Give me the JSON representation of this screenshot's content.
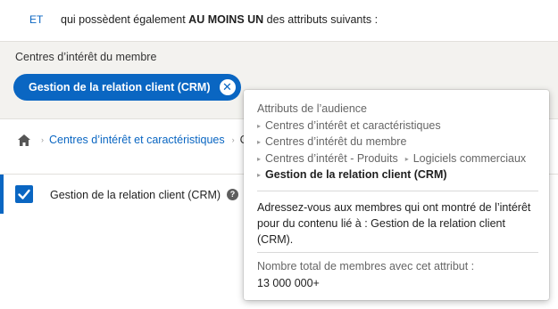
{
  "condition": {
    "operator": "ET",
    "text_before": "qui possèdent également ",
    "emphasis": "AU MOINS UN",
    "text_after": " des attributs suivants :"
  },
  "interests": {
    "label": "Centres d’intérêt du membre",
    "selected_pill": "Gestion de la relation client (CRM)",
    "remove_icon": "close-circle-icon"
  },
  "breadcrumb": {
    "home_icon": "home-icon",
    "link": "Centres d’intérêt et caractéristiques",
    "truncated": "C"
  },
  "result_row": {
    "checked": true,
    "label": "Gestion de la relation client (CRM)",
    "help_icon": "question-circle-icon"
  },
  "tooltip": {
    "title": "Attributs de l’audience",
    "path": [
      "Centres d’intérêt et caractéristiques",
      "Centres d’intérêt du membre",
      "Centres d’intérêt - Produits",
      "Logiciels commerciaux",
      "Gestion de la relation client (CRM)"
    ],
    "description": "Adressez-vous aux membres qui ont montré de l’intérêt pour du contenu lié à : Gestion de la relation client (CRM).",
    "count_label": "Nombre total de membres avec cet attribut :",
    "count_value": "13 000 000+"
  },
  "colors": {
    "accent": "#0a66c2",
    "panel_bg": "#f3f2ef"
  }
}
